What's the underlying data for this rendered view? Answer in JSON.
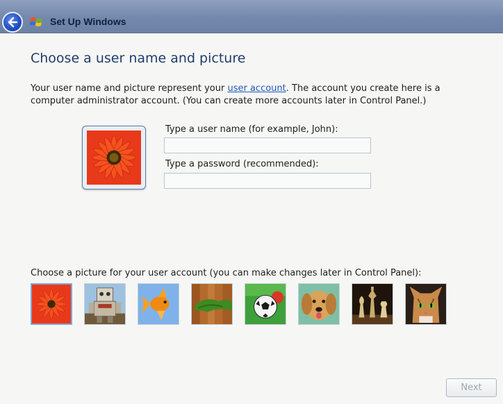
{
  "window": {
    "title": "Set Up Windows"
  },
  "page": {
    "heading": "Choose a user name and picture",
    "description_before_link": "Your user name and picture represent your ",
    "description_link": "user account",
    "description_after_link": ". The account you create here is a computer administrator account. (You can create more accounts later in Control Panel.)"
  },
  "form": {
    "username_label": "Type a user name (for example, John):",
    "username_value": "",
    "password_label": "Type a password (recommended):",
    "password_value": ""
  },
  "pictures": {
    "label": "Choose a picture for your user account (you can make changes later in Control Panel):",
    "items": [
      "flower",
      "robot",
      "goldfish",
      "bamboo",
      "soccer-ball",
      "dog",
      "chess",
      "kitten"
    ],
    "selected": "flower"
  },
  "buttons": {
    "next_label": "Next"
  },
  "colors": {
    "title_bar": "#7488ad",
    "heading": "#203c6b",
    "link": "#2358b6",
    "disabled_text": "#a1a7ad"
  }
}
